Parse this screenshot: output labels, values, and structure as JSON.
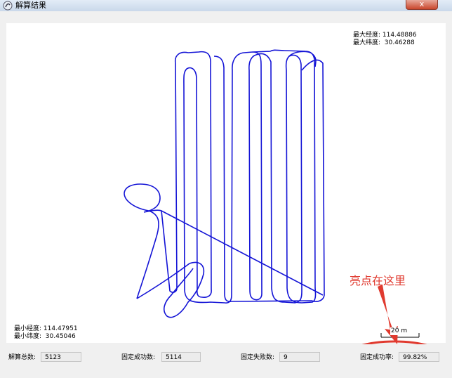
{
  "window": {
    "title": "解算结果",
    "close_label": "x"
  },
  "coords": {
    "max_lon_label": "最大经度:",
    "max_lon": "114.48886",
    "max_lat_label": "最大纬度:",
    "max_lat": "30.46288",
    "min_lon_label": "最小经度:",
    "min_lon": "114.47951",
    "min_lat_label": "最小纬度:",
    "min_lat": "30.45046"
  },
  "scale_bar": {
    "label": "20 m"
  },
  "stats": {
    "total_label": "解算总数:",
    "total_value": "5123",
    "fixed_success_label": "固定成功数:",
    "fixed_success_value": "5114",
    "fixed_fail_label": "固定失败数:",
    "fixed_fail_value": "9",
    "fixed_rate_label": "固定成功率:",
    "fixed_rate_value": "99.82%"
  },
  "annotation": {
    "text": "亮点在这里",
    "color": "#e03a2f"
  },
  "colors": {
    "track": "#1414d6",
    "highlight": "#e03a2f"
  }
}
